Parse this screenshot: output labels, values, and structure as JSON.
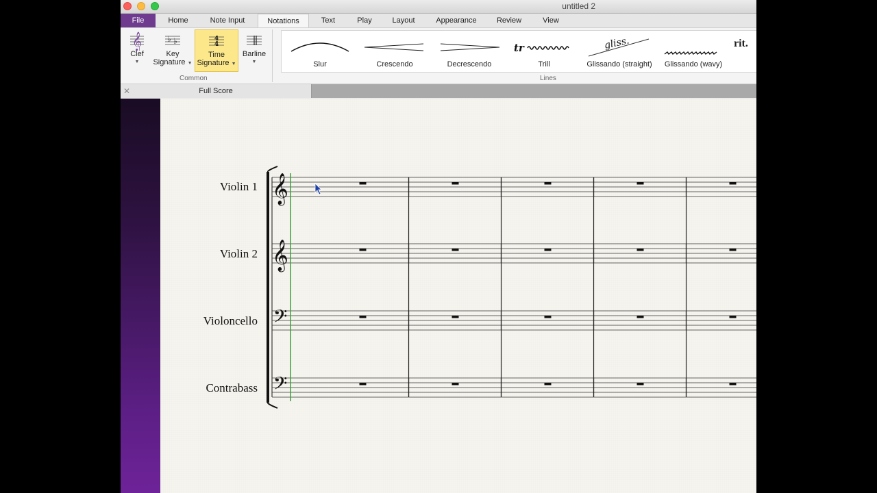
{
  "window": {
    "title": "untitled 2"
  },
  "tabs": [
    {
      "label": "File"
    },
    {
      "label": "Home"
    },
    {
      "label": "Note Input"
    },
    {
      "label": "Notations"
    },
    {
      "label": "Text"
    },
    {
      "label": "Play"
    },
    {
      "label": "Layout"
    },
    {
      "label": "Appearance"
    },
    {
      "label": "Review"
    },
    {
      "label": "View"
    }
  ],
  "ribbon": {
    "common": {
      "label": "Common",
      "clef": {
        "line1": "Clef",
        "line2": ""
      },
      "key_signature": {
        "line1": "Key",
        "line2": "Signature"
      },
      "time_signature": {
        "line1": "Time",
        "line2": "Signature"
      },
      "barline": {
        "line1": "Barline",
        "line2": ""
      }
    },
    "lines": {
      "label": "Lines",
      "items": [
        {
          "label": "Slur"
        },
        {
          "label": "Crescendo"
        },
        {
          "label": "Decrescendo"
        },
        {
          "label": "Trill",
          "glyph": "tr"
        },
        {
          "label": "Glissando (straight)",
          "glyph": "gliss."
        },
        {
          "label": "Glissando (wavy)"
        }
      ],
      "overflow_text": "rit."
    }
  },
  "score_tab": {
    "name": "Full Score",
    "close": "✕"
  },
  "score": {
    "instruments": [
      {
        "name": "Violin 1",
        "clef": "treble"
      },
      {
        "name": "Violin 2",
        "clef": "treble"
      },
      {
        "name": "Violoncello",
        "clef": "bass"
      },
      {
        "name": "Contrabass",
        "clef": "bass"
      }
    ],
    "measures": 5,
    "rest": "whole-rest"
  },
  "colors": {
    "file_tab": "#6f3b8e",
    "selected_button": "#fce88a",
    "cursor_line": "#3aa03a"
  }
}
